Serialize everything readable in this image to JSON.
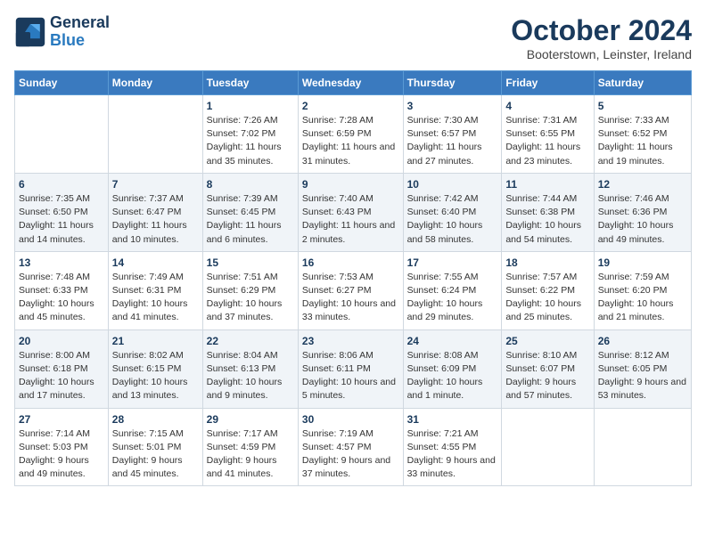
{
  "logo": {
    "line1": "General",
    "line2": "Blue"
  },
  "title": "October 2024",
  "subtitle": "Booterstown, Leinster, Ireland",
  "days_of_week": [
    "Sunday",
    "Monday",
    "Tuesday",
    "Wednesday",
    "Thursday",
    "Friday",
    "Saturday"
  ],
  "weeks": [
    [
      {
        "day": "",
        "sunrise": "",
        "sunset": "",
        "daylight": ""
      },
      {
        "day": "",
        "sunrise": "",
        "sunset": "",
        "daylight": ""
      },
      {
        "day": "1",
        "sunrise": "Sunrise: 7:26 AM",
        "sunset": "Sunset: 7:02 PM",
        "daylight": "Daylight: 11 hours and 35 minutes."
      },
      {
        "day": "2",
        "sunrise": "Sunrise: 7:28 AM",
        "sunset": "Sunset: 6:59 PM",
        "daylight": "Daylight: 11 hours and 31 minutes."
      },
      {
        "day": "3",
        "sunrise": "Sunrise: 7:30 AM",
        "sunset": "Sunset: 6:57 PM",
        "daylight": "Daylight: 11 hours and 27 minutes."
      },
      {
        "day": "4",
        "sunrise": "Sunrise: 7:31 AM",
        "sunset": "Sunset: 6:55 PM",
        "daylight": "Daylight: 11 hours and 23 minutes."
      },
      {
        "day": "5",
        "sunrise": "Sunrise: 7:33 AM",
        "sunset": "Sunset: 6:52 PM",
        "daylight": "Daylight: 11 hours and 19 minutes."
      }
    ],
    [
      {
        "day": "6",
        "sunrise": "Sunrise: 7:35 AM",
        "sunset": "Sunset: 6:50 PM",
        "daylight": "Daylight: 11 hours and 14 minutes."
      },
      {
        "day": "7",
        "sunrise": "Sunrise: 7:37 AM",
        "sunset": "Sunset: 6:47 PM",
        "daylight": "Daylight: 11 hours and 10 minutes."
      },
      {
        "day": "8",
        "sunrise": "Sunrise: 7:39 AM",
        "sunset": "Sunset: 6:45 PM",
        "daylight": "Daylight: 11 hours and 6 minutes."
      },
      {
        "day": "9",
        "sunrise": "Sunrise: 7:40 AM",
        "sunset": "Sunset: 6:43 PM",
        "daylight": "Daylight: 11 hours and 2 minutes."
      },
      {
        "day": "10",
        "sunrise": "Sunrise: 7:42 AM",
        "sunset": "Sunset: 6:40 PM",
        "daylight": "Daylight: 10 hours and 58 minutes."
      },
      {
        "day": "11",
        "sunrise": "Sunrise: 7:44 AM",
        "sunset": "Sunset: 6:38 PM",
        "daylight": "Daylight: 10 hours and 54 minutes."
      },
      {
        "day": "12",
        "sunrise": "Sunrise: 7:46 AM",
        "sunset": "Sunset: 6:36 PM",
        "daylight": "Daylight: 10 hours and 49 minutes."
      }
    ],
    [
      {
        "day": "13",
        "sunrise": "Sunrise: 7:48 AM",
        "sunset": "Sunset: 6:33 PM",
        "daylight": "Daylight: 10 hours and 45 minutes."
      },
      {
        "day": "14",
        "sunrise": "Sunrise: 7:49 AM",
        "sunset": "Sunset: 6:31 PM",
        "daylight": "Daylight: 10 hours and 41 minutes."
      },
      {
        "day": "15",
        "sunrise": "Sunrise: 7:51 AM",
        "sunset": "Sunset: 6:29 PM",
        "daylight": "Daylight: 10 hours and 37 minutes."
      },
      {
        "day": "16",
        "sunrise": "Sunrise: 7:53 AM",
        "sunset": "Sunset: 6:27 PM",
        "daylight": "Daylight: 10 hours and 33 minutes."
      },
      {
        "day": "17",
        "sunrise": "Sunrise: 7:55 AM",
        "sunset": "Sunset: 6:24 PM",
        "daylight": "Daylight: 10 hours and 29 minutes."
      },
      {
        "day": "18",
        "sunrise": "Sunrise: 7:57 AM",
        "sunset": "Sunset: 6:22 PM",
        "daylight": "Daylight: 10 hours and 25 minutes."
      },
      {
        "day": "19",
        "sunrise": "Sunrise: 7:59 AM",
        "sunset": "Sunset: 6:20 PM",
        "daylight": "Daylight: 10 hours and 21 minutes."
      }
    ],
    [
      {
        "day": "20",
        "sunrise": "Sunrise: 8:00 AM",
        "sunset": "Sunset: 6:18 PM",
        "daylight": "Daylight: 10 hours and 17 minutes."
      },
      {
        "day": "21",
        "sunrise": "Sunrise: 8:02 AM",
        "sunset": "Sunset: 6:15 PM",
        "daylight": "Daylight: 10 hours and 13 minutes."
      },
      {
        "day": "22",
        "sunrise": "Sunrise: 8:04 AM",
        "sunset": "Sunset: 6:13 PM",
        "daylight": "Daylight: 10 hours and 9 minutes."
      },
      {
        "day": "23",
        "sunrise": "Sunrise: 8:06 AM",
        "sunset": "Sunset: 6:11 PM",
        "daylight": "Daylight: 10 hours and 5 minutes."
      },
      {
        "day": "24",
        "sunrise": "Sunrise: 8:08 AM",
        "sunset": "Sunset: 6:09 PM",
        "daylight": "Daylight: 10 hours and 1 minute."
      },
      {
        "day": "25",
        "sunrise": "Sunrise: 8:10 AM",
        "sunset": "Sunset: 6:07 PM",
        "daylight": "Daylight: 9 hours and 57 minutes."
      },
      {
        "day": "26",
        "sunrise": "Sunrise: 8:12 AM",
        "sunset": "Sunset: 6:05 PM",
        "daylight": "Daylight: 9 hours and 53 minutes."
      }
    ],
    [
      {
        "day": "27",
        "sunrise": "Sunrise: 7:14 AM",
        "sunset": "Sunset: 5:03 PM",
        "daylight": "Daylight: 9 hours and 49 minutes."
      },
      {
        "day": "28",
        "sunrise": "Sunrise: 7:15 AM",
        "sunset": "Sunset: 5:01 PM",
        "daylight": "Daylight: 9 hours and 45 minutes."
      },
      {
        "day": "29",
        "sunrise": "Sunrise: 7:17 AM",
        "sunset": "Sunset: 4:59 PM",
        "daylight": "Daylight: 9 hours and 41 minutes."
      },
      {
        "day": "30",
        "sunrise": "Sunrise: 7:19 AM",
        "sunset": "Sunset: 4:57 PM",
        "daylight": "Daylight: 9 hours and 37 minutes."
      },
      {
        "day": "31",
        "sunrise": "Sunrise: 7:21 AM",
        "sunset": "Sunset: 4:55 PM",
        "daylight": "Daylight: 9 hours and 33 minutes."
      },
      {
        "day": "",
        "sunrise": "",
        "sunset": "",
        "daylight": ""
      },
      {
        "day": "",
        "sunrise": "",
        "sunset": "",
        "daylight": ""
      }
    ]
  ]
}
